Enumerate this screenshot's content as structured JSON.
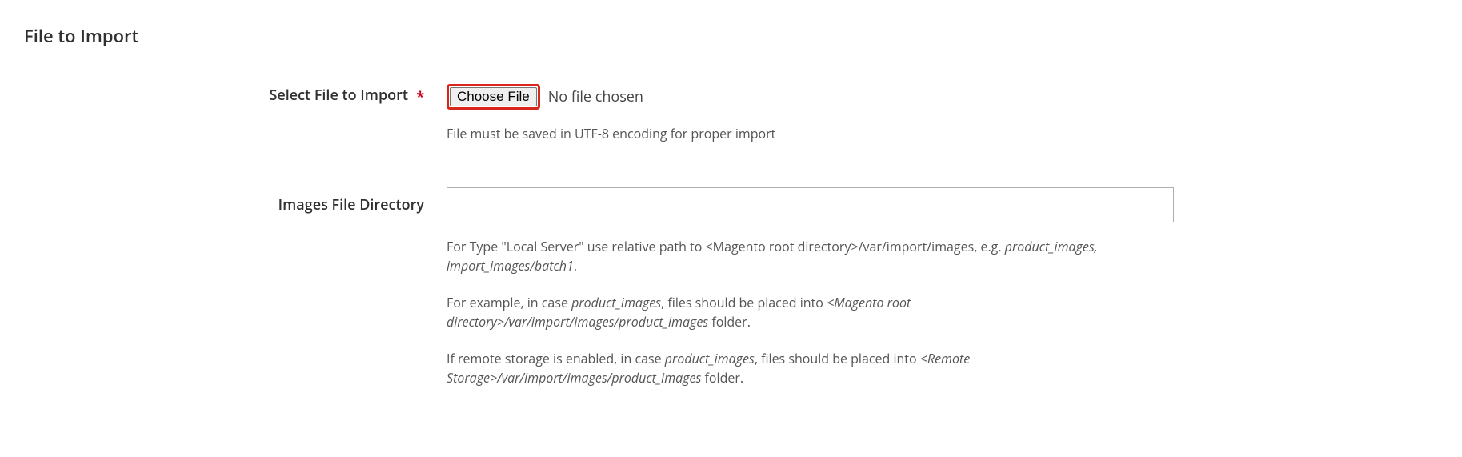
{
  "section_title": "File to Import",
  "fields": {
    "select_file": {
      "label": "Select File to Import",
      "required_mark": "*",
      "choose_button": "Choose File",
      "no_file_text": "No file chosen",
      "hint": "File must be saved in UTF-8 encoding for proper import"
    },
    "images_dir": {
      "label": "Images File Directory",
      "value": "",
      "hint_p1_a": "For Type \"Local Server\" use relative path to <Magento root directory>/var/import/images, e.g. ",
      "hint_p1_em": "product_images, import_images/batch1",
      "hint_p1_b": ".",
      "hint_p2_a": "For example, in case ",
      "hint_p2_em1": "product_images",
      "hint_p2_b": ", files should be placed into ",
      "hint_p2_em2": "<Magento root directory>/var/import/images/product_images",
      "hint_p2_c": " folder.",
      "hint_p3_a": "If remote storage is enabled, in case ",
      "hint_p3_em1": "product_images",
      "hint_p3_b": ", files should be placed into ",
      "hint_p3_em2": "<Remote Storage>/var/import/images/product_images",
      "hint_p3_c": " folder."
    }
  }
}
